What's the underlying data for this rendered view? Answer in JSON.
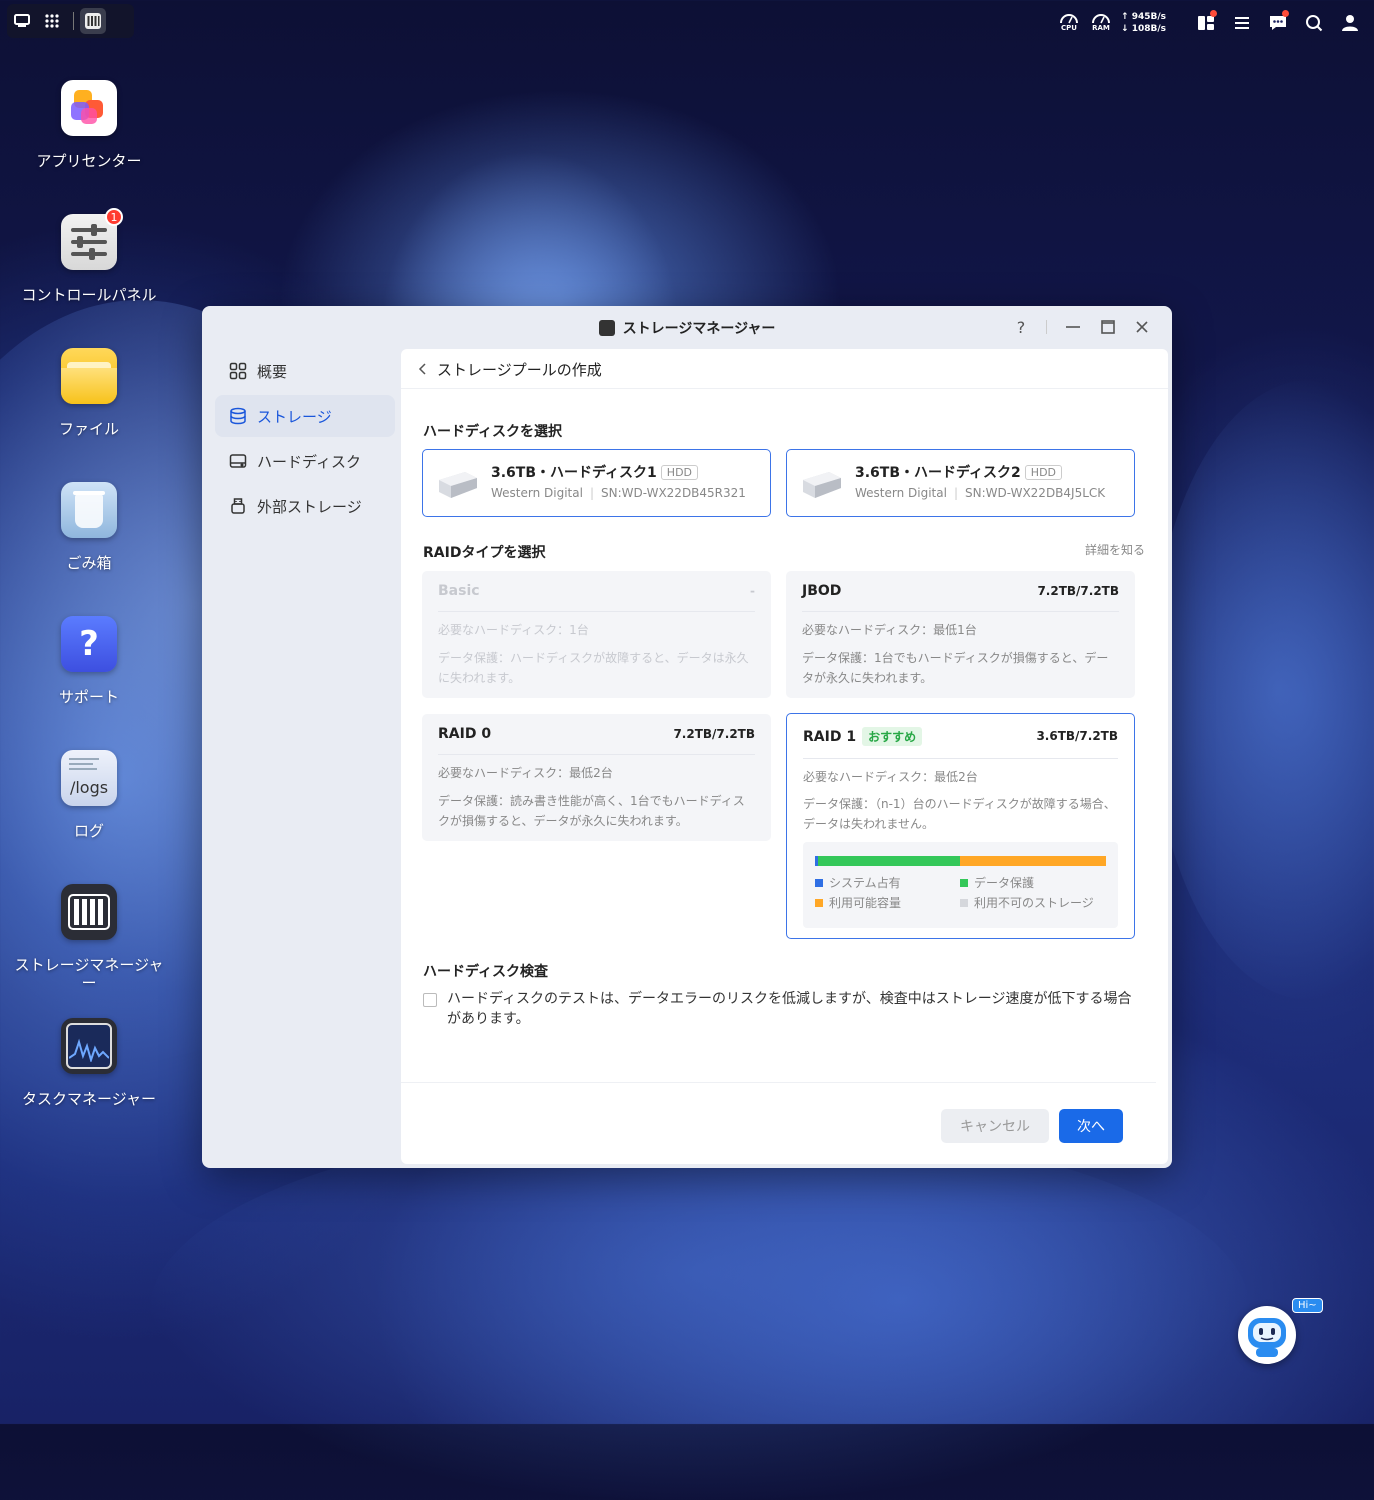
{
  "topbar": {
    "cpu_label": "CPU",
    "ram_label": "RAM",
    "upload": "945B/s",
    "download": "108B/s"
  },
  "desktop": {
    "icons": [
      {
        "label": "アプリセンター"
      },
      {
        "label": "コントロールパネル",
        "badge": "1"
      },
      {
        "label": "ファイル"
      },
      {
        "label": "ごみ箱"
      },
      {
        "label": "サポート"
      },
      {
        "label": "ログ",
        "image_text": "/logs"
      },
      {
        "label": "ストレージマネージャー"
      },
      {
        "label": "タスクマネージャー"
      }
    ]
  },
  "window": {
    "title": "ストレージマネージャー",
    "help": "?",
    "sidebar": [
      {
        "label": "概要",
        "icon": "grid-icon"
      },
      {
        "label": "ストレージ",
        "icon": "database-icon",
        "active": true
      },
      {
        "label": "ハードディスク",
        "icon": "hdd-icon"
      },
      {
        "label": "外部ストレージ",
        "icon": "usb-drive-icon"
      }
    ],
    "breadcrumb": "ストレージプールの作成",
    "disk_section_title": "ハードディスクを選択",
    "disks": [
      {
        "name": "3.6TB・ハードディスク1",
        "type": "HDD",
        "vendor": "Western Digital",
        "serial": "SN:WD-WX22DB45R321"
      },
      {
        "name": "3.6TB・ハードディスク2",
        "type": "HDD",
        "vendor": "Western Digital",
        "serial": "SN:WD-WX22DB4J5LCK"
      }
    ],
    "raid_section_title": "RAIDタイプを選択",
    "learn_more": "詳細を知る",
    "raids": [
      {
        "name": "Basic",
        "capacity": "-",
        "requirement": "必要なハードディスク：1台",
        "protection": "データ保護：ハードディスクが故障すると、データは永久に失われます。",
        "disabled": true
      },
      {
        "name": "JBOD",
        "capacity": "7.2TB/7.2TB",
        "requirement": "必要なハードディスク：最低1台",
        "protection": "データ保護：1台でもハードディスクが損傷すると、データが永久に失われます。"
      },
      {
        "name": "RAID 0",
        "capacity": "7.2TB/7.2TB",
        "requirement": "必要なハードディスク：最低2台",
        "protection": "データ保護：読み書き性能が高く、1台でもハードディスクが損傷すると、データが永久に失われます。"
      },
      {
        "name": "RAID 1",
        "recommended": "おすすめ",
        "capacity": "3.6TB/7.2TB",
        "requirement": "必要なハードディスク：最低2台",
        "protection": "データ保護：（n-1）台のハードディスクが故障する場合、データは失われません。",
        "selected": true
      }
    ],
    "usage": {
      "system_fraction": 0.01,
      "protection_fraction": 0.49,
      "available_fraction": 0.5,
      "legend": {
        "system": "システム占有",
        "protection": "データ保護",
        "available": "利用可能容量",
        "unavailable": "利用不可のストレージ"
      },
      "colors": {
        "system": "#2f6fe4",
        "protection": "#34c759",
        "available": "#ffa726",
        "unavailable": "#d5d7dc"
      }
    },
    "check_section_title": "ハードディスク検査",
    "check_text": "ハードディスクのテストは、データエラーのリスクを低減しますが、検査中はストレージ速度が低下する場合があります。",
    "check_checked": false,
    "cancel_label": "キャンセル",
    "next_label": "次へ"
  },
  "assistant": {
    "greeting": "Hi~"
  }
}
